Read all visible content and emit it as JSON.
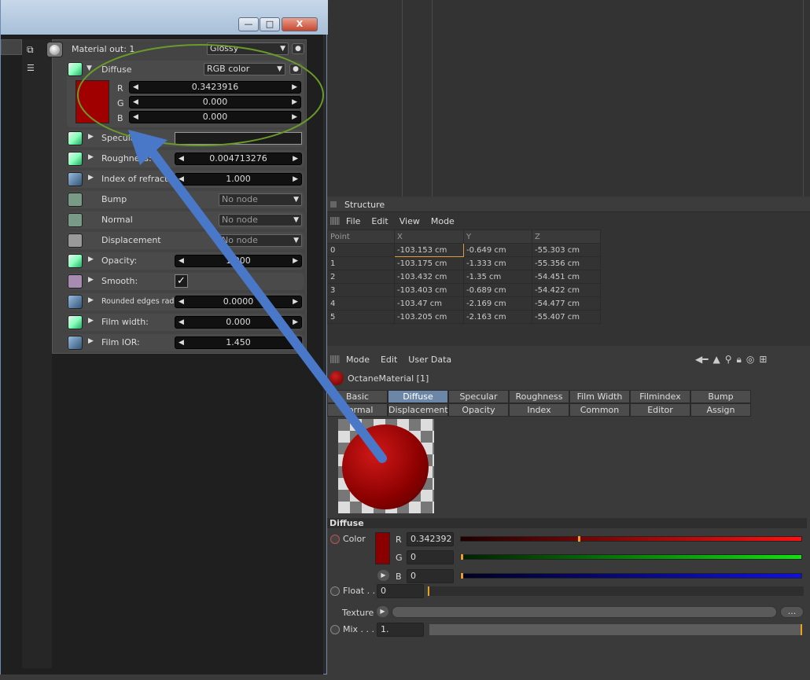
{
  "structure": {
    "title": "Structure",
    "menu": [
      "File",
      "Edit",
      "View",
      "Mode"
    ],
    "columns": [
      "Point",
      "X",
      "Y",
      "Z"
    ],
    "rows": [
      [
        "0",
        "-103.153 cm",
        "-0.649 cm",
        "-55.303 cm"
      ],
      [
        "1",
        "-103.175 cm",
        "-1.333 cm",
        "-55.356 cm"
      ],
      [
        "2",
        "-103.432 cm",
        "-1.35 cm",
        "-54.451 cm"
      ],
      [
        "3",
        "-103.403 cm",
        "-0.689 cm",
        "-54.422 cm"
      ],
      [
        "4",
        "-103.47 cm",
        "-2.169 cm",
        "-54.477 cm"
      ],
      [
        "5",
        "-103.205 cm",
        "-2.163 cm",
        "-55.407 cm"
      ]
    ]
  },
  "attributes": {
    "menu": [
      "Mode",
      "Edit",
      "User Data"
    ],
    "material_name": "OctaneMaterial [1]",
    "tabs_row1": [
      "Basic",
      "Diffuse",
      "Specular",
      "Roughness",
      "Film Width",
      "Filmindex",
      "Bump"
    ],
    "tabs_row2": [
      "Normal",
      "Displacement",
      "Opacity",
      "Index",
      "Common",
      "Editor",
      "Assign"
    ],
    "active_tab": "Diffuse",
    "section": "Diffuse",
    "color_label": "Color",
    "r_label": "R",
    "r_value": "0.342392",
    "r_slider": 0.3424,
    "g_label": "G",
    "g_value": "0",
    "g_slider": 0,
    "b_label": "B",
    "b_value": "0",
    "b_slider": 0,
    "float_label": "Float . .",
    "float_value": "0",
    "texture_label": "Texture",
    "texture_btn": "...",
    "mix_label": "Mix . . .",
    "mix_value": "1.",
    "swatch_color": "#8a0000"
  },
  "material_window": {
    "controls": {
      "minimize": "—",
      "maximize": "□",
      "close": "X"
    },
    "header_label": "Material out: 1",
    "material_type": "Glossy",
    "diffuse": {
      "label": "Diffuse",
      "mode": "RGB color",
      "r_label": "R",
      "r": "0.3423916",
      "g_label": "G",
      "g": "0.000",
      "b_label": "B",
      "b": "0.000",
      "swatch": "#a00000"
    },
    "rows": [
      {
        "label": "Specular",
        "type": "color"
      },
      {
        "label": "Roughness:",
        "value": "0.004713276"
      },
      {
        "label": "Index of refraction:",
        "value": "1.000"
      },
      {
        "label": "Bump",
        "node": "No node"
      },
      {
        "label": "Normal",
        "node": "No node"
      },
      {
        "label": "Displacement",
        "node": "No node"
      },
      {
        "label": "Opacity:",
        "value": "1.000"
      },
      {
        "label": "Smooth:",
        "check": "✓"
      },
      {
        "label": "Rounded edges radius:",
        "value": "0.0000"
      },
      {
        "label": "Film width:",
        "value": "0.000"
      },
      {
        "label": "Film IOR:",
        "value": "1.450"
      }
    ]
  },
  "colors": {
    "annotation_circle": "#6a9a2a",
    "annotation_arrow": "#4a78c8",
    "active_tab": "#6c86a8"
  }
}
